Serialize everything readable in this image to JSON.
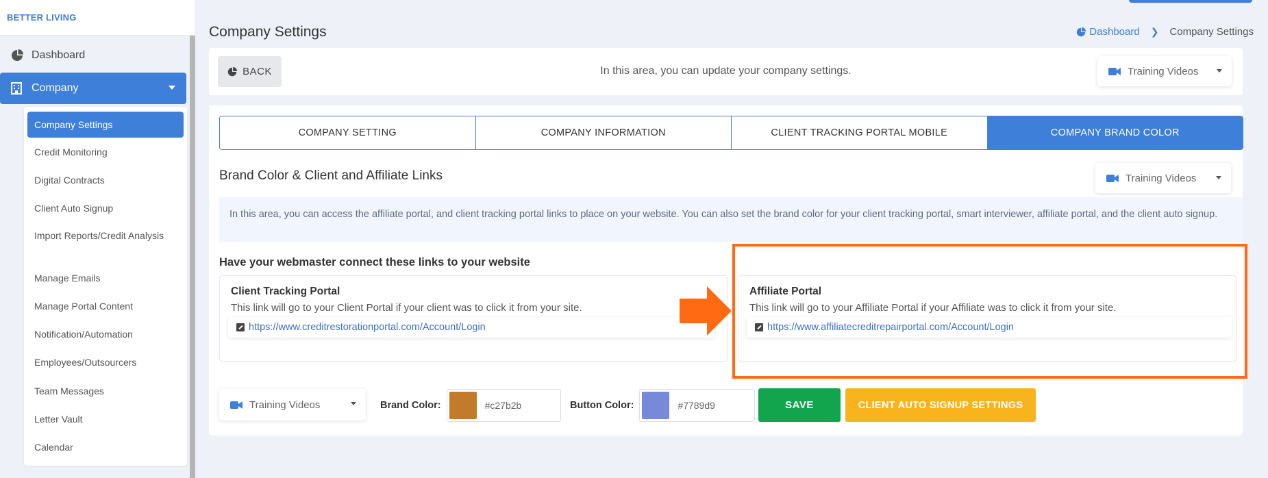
{
  "app": {
    "brand": "BETTER LIVING"
  },
  "sidebar": {
    "dashboard_label": "Dashboard",
    "company_label": "Company",
    "submenu": [
      "Company Settings",
      "Credit Monitoring",
      "Digital Contracts",
      "Client Auto Signup",
      "Import Reports/Credit Analysis",
      "Manage Emails",
      "Manage Portal Content",
      "Notification/Automation",
      "Employees/Outsourcers",
      "Team Messages",
      "Letter Vault",
      "Calendar"
    ],
    "active_item": "Company Settings"
  },
  "header": {
    "title": "Company Settings",
    "breadcrumb": [
      "Dashboard",
      "Company Settings"
    ]
  },
  "top_card": {
    "back_label": "BACK",
    "description": "In this area, you can update your company settings.",
    "training_videos_label": "Training Videos"
  },
  "tabs": [
    "COMPANY SETTING",
    "COMPANY INFORMATION",
    "CLIENT TRACKING PORTAL MOBILE",
    "COMPANY BRAND COLOR"
  ],
  "active_tab": "COMPANY BRAND COLOR",
  "brand_section": {
    "title": "Brand Color & Client and Affiliate Links",
    "training_videos_label": "Training Videos",
    "info": "In this area, you can access the affiliate portal, and client tracking portal links to place on your website. You can also set the brand color for your client tracking portal, smart interviewer, affiliate portal, and the client auto signup.",
    "links_title": "Have your webmaster connect these links to your website",
    "client_portal": {
      "title": "Client Tracking Portal",
      "description": "This link will go to your Client Portal if your client was to click it from your site.",
      "url": "https://www.creditrestorationportal.com/Account/Login"
    },
    "affiliate_portal": {
      "title": "Affiliate Portal",
      "description": "This link will go to your Affiliate Portal if your Affiliate was to click it from your site.",
      "url": "https://www.affiliatecreditrepairportal.com/Account/Login"
    }
  },
  "bottom_bar": {
    "training_videos_label": "Training Videos",
    "brand_color_label": "Brand Color:",
    "brand_color_value": "#c27b2b",
    "button_color_label": "Button Color:",
    "button_color_value": "#7789d9",
    "save_label": "SAVE",
    "auto_signup_label": "CLIENT AUTO SIGNUP SETTINGS"
  },
  "colors": {
    "accent": "#3e7fd9",
    "highlight": "#ff6a13",
    "save": "#13a54d",
    "auto_signup": "#f9b31c"
  }
}
